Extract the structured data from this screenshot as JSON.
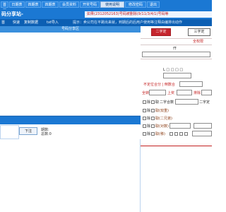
{
  "nav": {
    "tabs": [
      {
        "label": "首页",
        "active": false
      },
      {
        "label": "日期表",
        "active": false
      },
      {
        "label": "四期表",
        "active": false
      },
      {
        "label": "四期表",
        "active": false
      },
      {
        "label": "会员资料",
        "active": false
      },
      {
        "label": "开奖号码",
        "active": false
      },
      {
        "label": "使用说明",
        "active": true
      },
      {
        "label": "修改密码",
        "active": false
      },
      {
        "label": "退出",
        "active": false
      }
    ]
  },
  "header": {
    "logo_text": "码分享站-ymfxz.com",
    "notice": "如果(2312052163)号码被删除(9/11/3/4/1)号码等"
  },
  "toolbar": {
    "items": [
      "首",
      "快速",
      "复制数据",
      "txt导入"
    ],
    "marquee": "提示：卖公司在平跳出来就，到期后的后用户使用等注释由编排出动作"
  },
  "left": {
    "header": "号码分享区",
    "download_button": "下注",
    "count_line1": "期数:",
    "count_line2": "总数:0"
  },
  "right": {
    "primary_button": "二字定",
    "secondary_button": "三字定",
    "label_top_right": "全权限",
    "label_qian": "仟",
    "label_checkbox_row": "L □ □ □ □",
    "label_row_a": "不定位合分 | 倒数合",
    "label_row_b1": "全转",
    "label_row_b2": "上奖",
    "label_row_b3": "排除",
    "label_row_c1": "除",
    "label_row_c2": "取",
    "label_row_c3": "二字合数",
    "label_row_c4": "二字定",
    "label_row_d": "取(双重)",
    "label_row_e": "取(二兄弟)",
    "label_row_f": "取(对数)",
    "label_row_g": "取(移)"
  }
}
